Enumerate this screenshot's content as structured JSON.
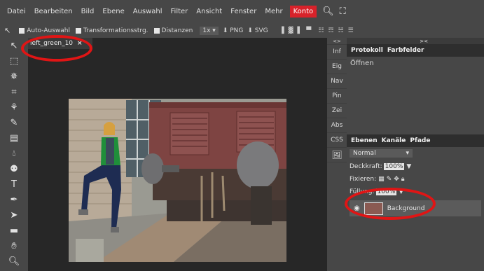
{
  "menu": {
    "items": [
      "Datei",
      "Bearbeiten",
      "Bild",
      "Ebene",
      "Auswahl",
      "Filter",
      "Ansicht",
      "Fenster",
      "Mehr"
    ],
    "account": "Konto"
  },
  "options_bar": {
    "auto_select": "Auto-Auswahl",
    "transform": "Transformationsstrg.",
    "distances": "Distanzen",
    "zoom": "1x",
    "png": "PNG",
    "svg": "SVG"
  },
  "document": {
    "tab_title": "left_green_10",
    "close": "×"
  },
  "mini_panels": [
    "Inf",
    "Eig",
    "Nav",
    "Pin",
    "Zei",
    "Abs",
    "CSS"
  ],
  "history_panel": {
    "tabs": [
      "Protokoll",
      "Farbfelder"
    ],
    "items": [
      "Öffnen"
    ]
  },
  "layers_panel": {
    "tabs": [
      "Ebenen",
      "Kanäle",
      "Pfade"
    ],
    "blend_mode": "Normal",
    "opacity_label": "Deckkraft:",
    "opacity_value": "100%",
    "lock_label": "Fixieren:",
    "fill_label": "Füllung:",
    "fill_value": "100%",
    "layer_name": "Background"
  },
  "colors": {
    "accent_red": "#d8222a",
    "annotation_red": "#e01515",
    "ui_gray": "#474747",
    "canvas_bg": "#272727"
  }
}
